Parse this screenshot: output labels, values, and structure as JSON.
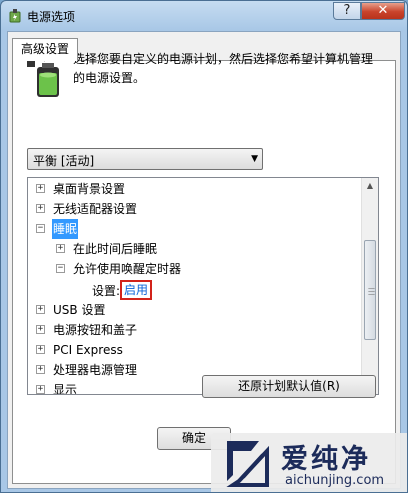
{
  "window": {
    "title": "电源选项",
    "help_label": "?",
    "close_label": "✕"
  },
  "tab": {
    "label": "高级设置"
  },
  "description": "选择您要自定义的电源计划，然后选择您希望计算机管理的电源设置。",
  "plan_select": {
    "value": "平衡 [活动]"
  },
  "tree": {
    "items": [
      {
        "label": "桌面背景设置",
        "expander": "+"
      },
      {
        "label": "无线适配器设置",
        "expander": "+"
      },
      {
        "label": "睡眠",
        "expander": "−"
      },
      {
        "label": "在此时间后睡眠",
        "expander": "+"
      },
      {
        "label": "允许使用唤醒定时器",
        "expander": "−"
      },
      {
        "label": "设置:",
        "value": "启用"
      },
      {
        "label": "USB 设置",
        "expander": "+"
      },
      {
        "label": "电源按钮和盖子",
        "expander": "+"
      },
      {
        "label": "PCI Express",
        "expander": "+"
      },
      {
        "label": "处理器电源管理",
        "expander": "+"
      },
      {
        "label": "显示",
        "expander": "+"
      }
    ]
  },
  "buttons": {
    "restore_defaults": "还原计划默认值(R)",
    "ok": "确定"
  },
  "watermark": {
    "name": "爱纯净",
    "url": "aichunjing.com"
  }
}
